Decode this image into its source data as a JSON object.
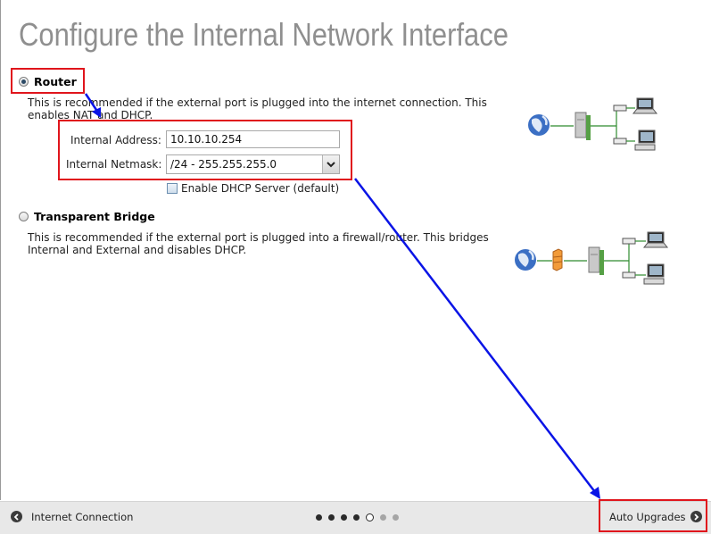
{
  "page": {
    "title": "Configure the Internal Network Interface"
  },
  "router_option": {
    "label": "Router",
    "selected": true,
    "description": "This is recommended if the external port is plugged into the internet connection. This enables NAT and DHCP.",
    "internal_address": {
      "label": "Internal Address:",
      "value": "10.10.10.254"
    },
    "internal_netmask": {
      "label": "Internal Netmask:",
      "selected": "/24 - 255.255.255.0"
    },
    "dhcp_checkbox": {
      "label": "Enable DHCP Server (default)",
      "checked": false
    }
  },
  "bridge_option": {
    "label": "Transparent Bridge",
    "selected": false,
    "description": "This is recommended if the external port is plugged into a firewall/router. This bridges Internal and External and disables DHCP."
  },
  "footer": {
    "back_label": "Internet Connection",
    "next_label": "Auto Upgrades",
    "steps_total": 7,
    "current_step": 5
  },
  "colors": {
    "highlight": "#e0151c",
    "arrow": "#0a14e6",
    "title": "#8f8f8f"
  },
  "icons": [
    "globe-icon",
    "firewall-icon",
    "server-icon",
    "switch-icon",
    "laptop-icon",
    "desktop-icon",
    "chevron-left-icon",
    "chevron-right-icon",
    "select-arrow-icon"
  ]
}
